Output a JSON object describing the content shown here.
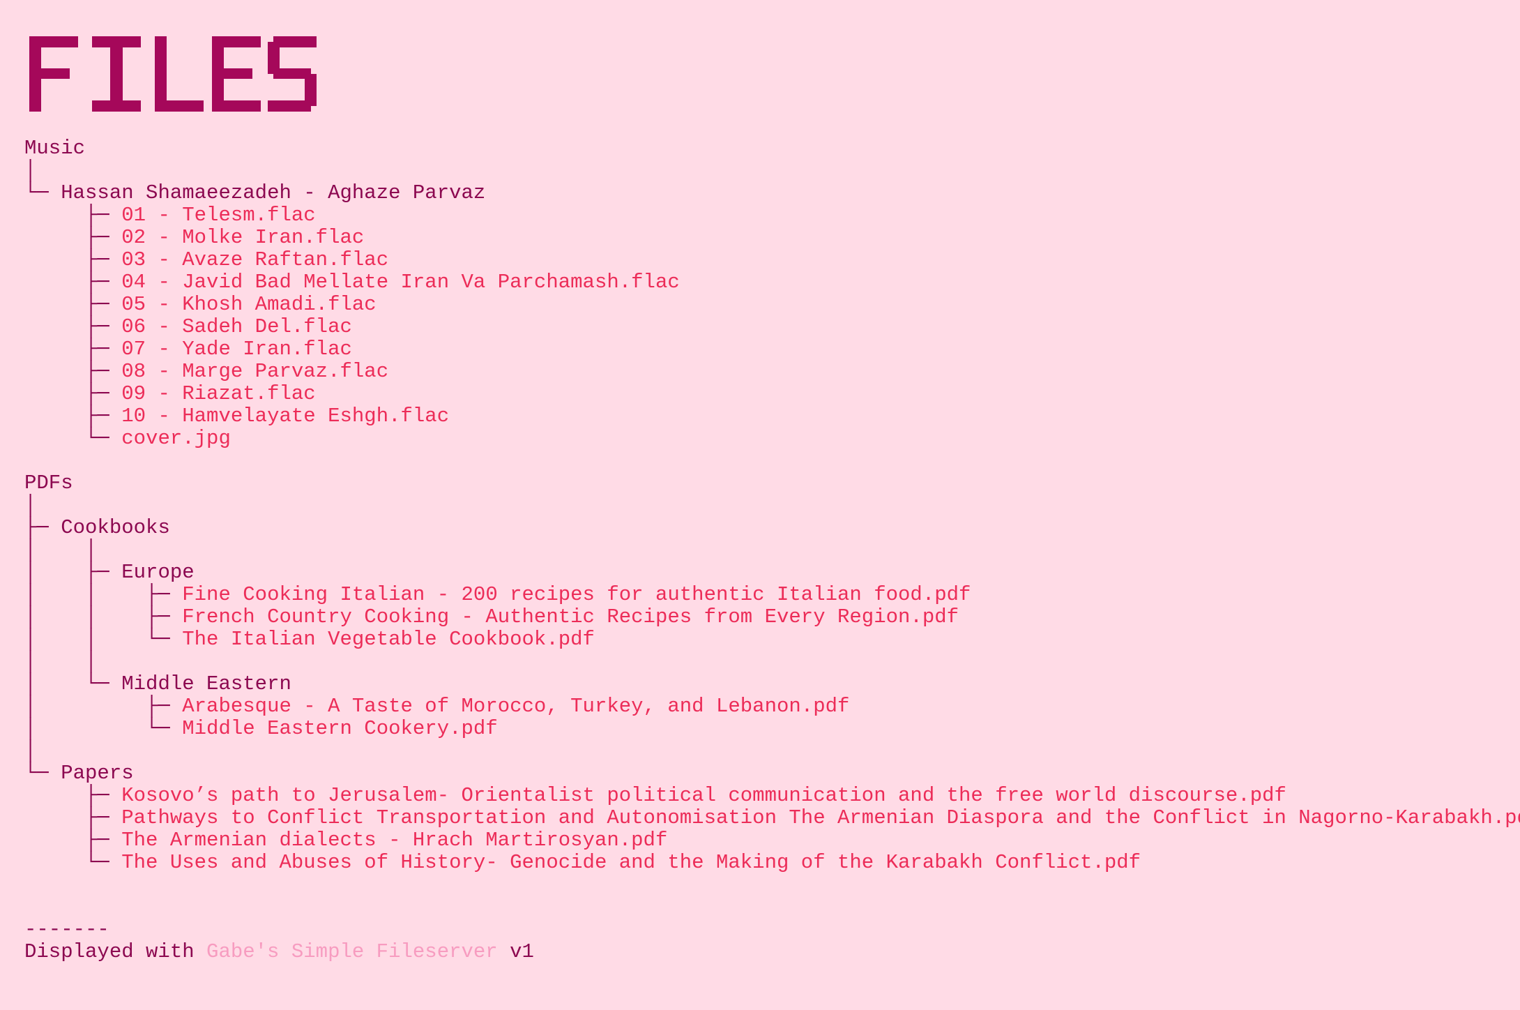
{
  "header": {
    "logo_text": "FILES",
    "logo_color": "#a5085a"
  },
  "colors": {
    "background": "#ffdbe6",
    "directory": "#8c0850",
    "file": "#ec2c58",
    "footer_link": "#f79cc0"
  },
  "music": {
    "label": "Music",
    "album": {
      "label": "Hassan Shamaeezadeh - Aghaze Parvaz",
      "files": [
        "01 - Telesm.flac",
        "02 - Molke Iran.flac",
        "03 - Avaze Raftan.flac",
        "04 - Javid Bad Mellate Iran Va Parchamash.flac",
        "05 - Khosh Amadi.flac",
        "06 - Sadeh Del.flac",
        "07 - Yade Iran.flac",
        "08 - Marge Parvaz.flac",
        "09 - Riazat.flac",
        "10 - Hamvelayate Eshgh.flac",
        "cover.jpg"
      ]
    }
  },
  "pdfs": {
    "label": "PDFs",
    "cookbooks": {
      "label": "Cookbooks",
      "europe": {
        "label": "Europe",
        "files": [
          "Fine Cooking Italian - 200 recipes for authentic Italian food.pdf",
          "French Country Cooking - Authentic Recipes from Every Region.pdf",
          "The Italian Vegetable Cookbook.pdf"
        ]
      },
      "middle_eastern": {
        "label": "Middle Eastern",
        "files": [
          "Arabesque - A Taste of Morocco, Turkey, and Lebanon.pdf",
          "Middle Eastern Cookery.pdf"
        ]
      }
    },
    "papers": {
      "label": "Papers",
      "files": [
        "Kosovo’s path to Jerusalem- Orientalist political communication and the free world discourse.pdf",
        "Pathways to Conflict Transportation and Autonomisation The Armenian Diaspora and the Conflict in Nagorno-Karabakh.pdf",
        "The Armenian dialects - Hrach Martirosyan.pdf",
        "The Uses and Abuses of History- Genocide and the Making of the Karabakh Conflict.pdf"
      ]
    }
  },
  "footer": {
    "divider": "-------",
    "prefix": "Displayed with ",
    "link_text": "Gabe's Simple Fileserver",
    "suffix": " v1"
  }
}
